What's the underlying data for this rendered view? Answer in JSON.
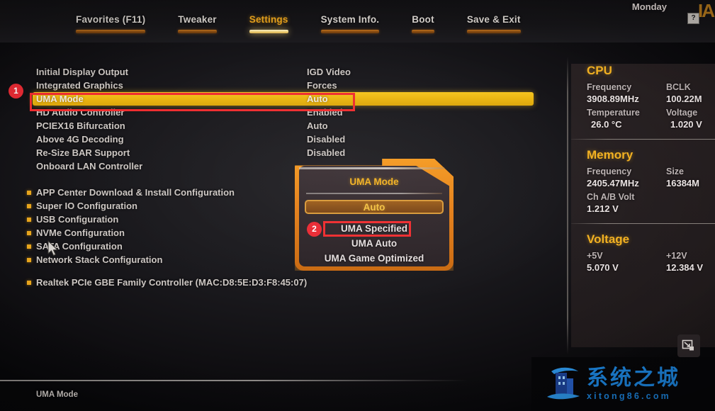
{
  "topbar": {
    "tabs": [
      {
        "label": "Favorites (F11)",
        "active": false
      },
      {
        "label": "Tweaker",
        "active": false
      },
      {
        "label": "Settings",
        "active": true
      },
      {
        "label": "System Info.",
        "active": false
      },
      {
        "label": "Boot",
        "active": false
      },
      {
        "label": "Save & Exit",
        "active": false
      }
    ],
    "clock_day": "Monday",
    "help_badge": "?",
    "brand_fragment": "IA"
  },
  "settings": [
    {
      "name": "Initial Display Output",
      "value": "IGD Video",
      "selected": false
    },
    {
      "name": "Integrated Graphics",
      "value": "Forces",
      "selected": false
    },
    {
      "name": "UMA Mode",
      "value": "Auto",
      "selected": true
    },
    {
      "name": "HD Audio Controller",
      "value": "Enabled",
      "selected": false
    },
    {
      "name": "PCIEX16 Bifurcation",
      "value": "Auto",
      "selected": false
    },
    {
      "name": "Above 4G Decoding",
      "value": "Disabled",
      "selected": false
    },
    {
      "name": "Re-Size BAR Support",
      "value": "Disabled",
      "selected": false
    },
    {
      "name": "Onboard LAN Controller",
      "value": "",
      "selected": false
    }
  ],
  "submenus": [
    {
      "label": "APP Center Download & Install Configuration"
    },
    {
      "label": "Super IO Configuration"
    },
    {
      "label": "USB Configuration"
    },
    {
      "label": "NVMe Configuration"
    },
    {
      "label": "SATA Configuration"
    },
    {
      "label": "Network Stack Configuration"
    }
  ],
  "extras": [
    {
      "label": "Realtek PCIe GBE Family Controller (MAC:D8:5E:D3:F8:45:07)"
    }
  ],
  "popup": {
    "title": "UMA Mode",
    "options": [
      {
        "label": "Auto",
        "selected": true
      },
      {
        "label": "UMA Specified",
        "selected": false
      },
      {
        "label": "UMA Auto",
        "selected": false
      },
      {
        "label": "UMA Game Optimized",
        "selected": false
      }
    ]
  },
  "info_panel": {
    "cpu": {
      "title": "CPU",
      "rows": [
        {
          "key": "Frequency",
          "value": "3908.89MHz",
          "key2": "BCLK",
          "value2": "100.22M"
        },
        {
          "key": "Temperature",
          "value": "26.0 °C",
          "key2": "Voltage",
          "value2": "1.020 V"
        }
      ]
    },
    "memory": {
      "title": "Memory",
      "rows": [
        {
          "key": "Frequency",
          "value": "2405.47MHz",
          "key2": "Size",
          "value2": "16384M"
        },
        {
          "key": "Ch A/B Volt",
          "value": "1.212 V",
          "key2": "",
          "value2": ""
        }
      ]
    },
    "voltage": {
      "title": "Voltage",
      "rows": [
        {
          "key": "+5V",
          "value": "5.070 V",
          "key2": "+12V",
          "value2": "12.384 V"
        }
      ]
    }
  },
  "bottom": {
    "label": "UMA Mode"
  },
  "annotations": [
    {
      "number": "1"
    },
    {
      "number": "2"
    }
  ],
  "watermark": {
    "cn_text": "系统之城",
    "url_text": "xitong86.com"
  },
  "colors": {
    "accent_amber": "#f2b122",
    "highlight_yellow": "#ecb712",
    "annotation_red": "#ef2d30",
    "watermark_blue": "#1b7fd4"
  }
}
